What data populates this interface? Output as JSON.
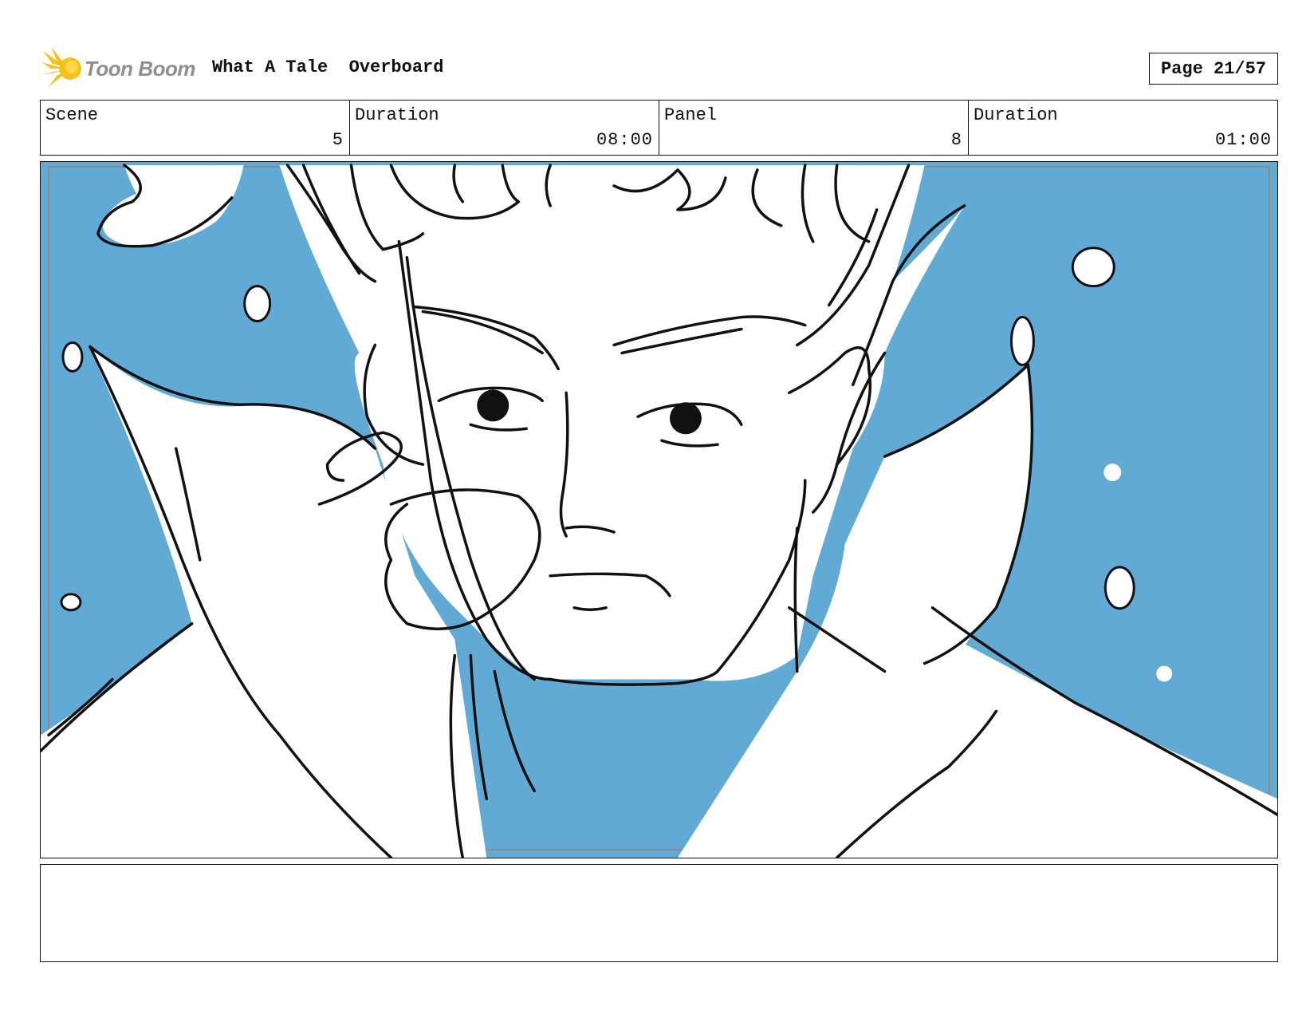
{
  "header": {
    "logo_text": "Toon Boom",
    "project_title": "What A Tale  Overboard",
    "page_label": "Page 21/57"
  },
  "info": {
    "scene_label": "Scene",
    "scene_value": "5",
    "scene_duration_label": "Duration",
    "scene_duration_value": "08:00",
    "panel_label": "Panel",
    "panel_value": "8",
    "panel_duration_label": "Duration",
    "panel_duration_value": "01:00"
  },
  "notes": {
    "text": ""
  },
  "colors": {
    "background_blue": "#62aad6",
    "ink": "#111111",
    "logo_yellow": "#f5c21b",
    "logo_text_gray": "#8f8f8f"
  }
}
